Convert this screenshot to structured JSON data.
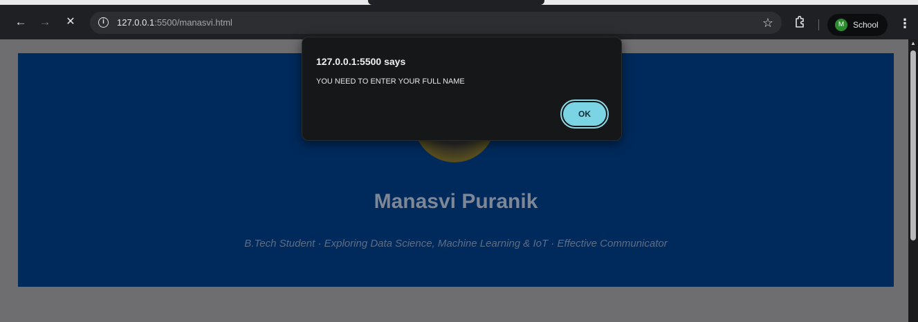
{
  "browser": {
    "url_host": "127.0.0.1",
    "url_rest": ":5500/manasvi.html",
    "profile_initial": "M",
    "profile_name": "School"
  },
  "hero": {
    "name": "Manasvi Puranik",
    "tagline": "B.Tech Student · Exploring Data Science, Machine Learning & IoT · Effective Communicator"
  },
  "dialog": {
    "title": "127.0.0.1:5500 says",
    "message": "YOU NEED TO ENTER YOUR FULL NAME",
    "ok_label": "OK"
  },
  "colors": {
    "hero_bg": "#012a5c",
    "ok_accent": "#7ad4e4"
  }
}
